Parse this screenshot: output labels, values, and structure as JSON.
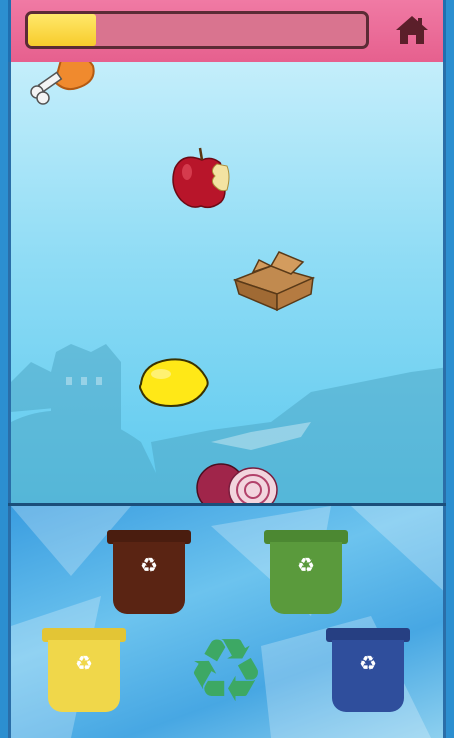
{
  "header": {
    "progress_fraction": 0.2,
    "icons": {
      "home": "home-icon"
    },
    "colors": {
      "bar_bg": "#e6608e",
      "progress_fill": "#f7cc2c"
    }
  },
  "playfield": {
    "falling_items": [
      {
        "name": "chicken-drumstick",
        "category": "organic"
      },
      {
        "name": "bitten-apple",
        "category": "organic"
      },
      {
        "name": "cardboard-box",
        "category": "paper"
      },
      {
        "name": "lemon",
        "category": "organic"
      },
      {
        "name": "red-onion",
        "category": "organic"
      }
    ]
  },
  "bins": [
    {
      "id": "brown",
      "color": "#5a2413",
      "icon": "recycle-icon"
    },
    {
      "id": "green",
      "color": "#5a9a3c",
      "icon": "recycle-icon"
    },
    {
      "id": "yellow",
      "color": "#f0d74a",
      "icon": "recycle-icon"
    },
    {
      "id": "blue",
      "color": "#2f4e9c",
      "icon": "recycle-icon"
    }
  ],
  "center_logo": {
    "icon": "recycle-logo-icon",
    "color": "#3da864"
  }
}
